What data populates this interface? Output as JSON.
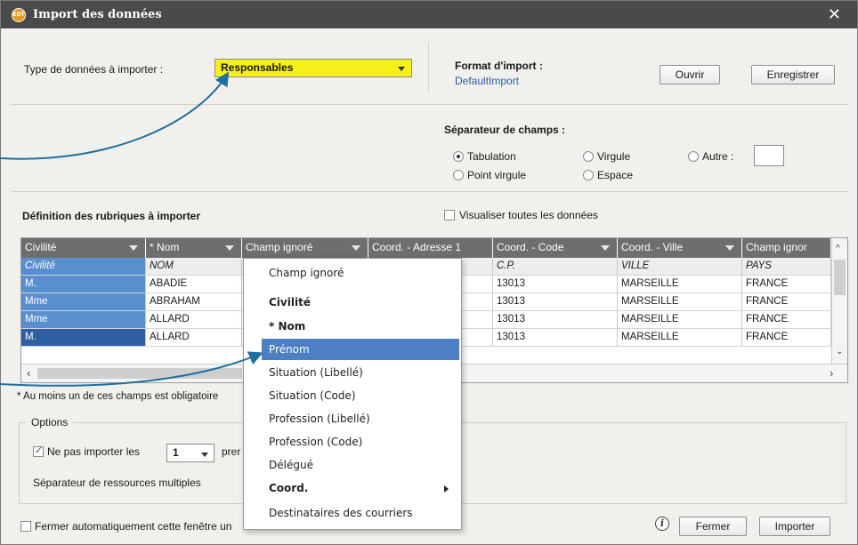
{
  "window": {
    "title": "Import des données",
    "app_icon_text": "EDT",
    "close_symbol": "✕"
  },
  "type_section": {
    "label": "Type de données à importer :",
    "selected": "Responsables"
  },
  "format_section": {
    "label": "Format d'import :",
    "value": "DefaultImport",
    "open_button": "Ouvrir",
    "save_button": "Enregistrer"
  },
  "separator_section": {
    "label": "Séparateur de champs :",
    "options": {
      "tabulation": "Tabulation",
      "virgule": "Virgule",
      "autre": "Autre :",
      "point_virgule": "Point virgule",
      "espace": "Espace"
    },
    "selected": "tabulation"
  },
  "definition_section": {
    "label": "Définition des rubriques à importer",
    "show_all_label": "Visualiser toutes les données"
  },
  "grid": {
    "headers": [
      "Civilité",
      "* Nom",
      "Champ ignoré",
      "Coord. - Adresse 1",
      "Coord. - Code",
      "Coord. - Ville",
      "Champ ignor"
    ],
    "source_row": [
      "Civilité",
      "NOM",
      "",
      "",
      "C.P.",
      "VILLE",
      "PAYS"
    ],
    "rows": [
      [
        "M.",
        "ABADIE",
        "",
        "",
        "13013",
        "MARSEILLE",
        "FRANCE"
      ],
      [
        "Mme",
        "ABRAHAM",
        "",
        "",
        "13013",
        "MARSEILLE",
        "FRANCE"
      ],
      [
        "Mme",
        "ALLARD",
        "",
        "",
        "13013",
        "MARSEILLE",
        "FRANCE"
      ],
      [
        "M.",
        "ALLARD",
        "",
        "",
        "13013",
        "MARSEILLE",
        "FRANCE"
      ]
    ]
  },
  "required_note": "* Au moins un de ces champs est obligatoire",
  "options_section": {
    "label": "Options",
    "skip_label": "Ne pas importer les",
    "skip_value": "1",
    "skip_suffix": "prer",
    "multi_sep_label": "Séparateur de ressources multiples"
  },
  "footer": {
    "auto_close_label": "Fermer automatiquement cette fenêtre un",
    "close_button": "Fermer",
    "import_button": "Importer",
    "info_symbol": "i"
  },
  "menu": {
    "items": [
      {
        "label": "Champ ignoré",
        "style": "normal"
      },
      {
        "label": "Civilité",
        "style": "bold"
      },
      {
        "label": "* Nom",
        "style": "bold"
      },
      {
        "label": "Prénom",
        "style": "highlight"
      },
      {
        "label": "Situation (Libellé)",
        "style": "normal"
      },
      {
        "label": "Situation (Code)",
        "style": "normal"
      },
      {
        "label": "Profession (Libellé)",
        "style": "normal"
      },
      {
        "label": "Profession (Code)",
        "style": "normal"
      },
      {
        "label": "Délégué",
        "style": "normal"
      },
      {
        "label": "Coord.",
        "style": "bold-submenu"
      },
      {
        "label": "Destinataires des courriers",
        "style": "normal"
      }
    ]
  },
  "colors": {
    "titlebar": "#4a4a4a",
    "select_highlight": "#f5ef1a",
    "grid_header": "#6e6e6e",
    "first_column": "#5a8fcf",
    "menu_highlight": "#4d7fc4",
    "callout_arrow": "#1f6ea0"
  }
}
